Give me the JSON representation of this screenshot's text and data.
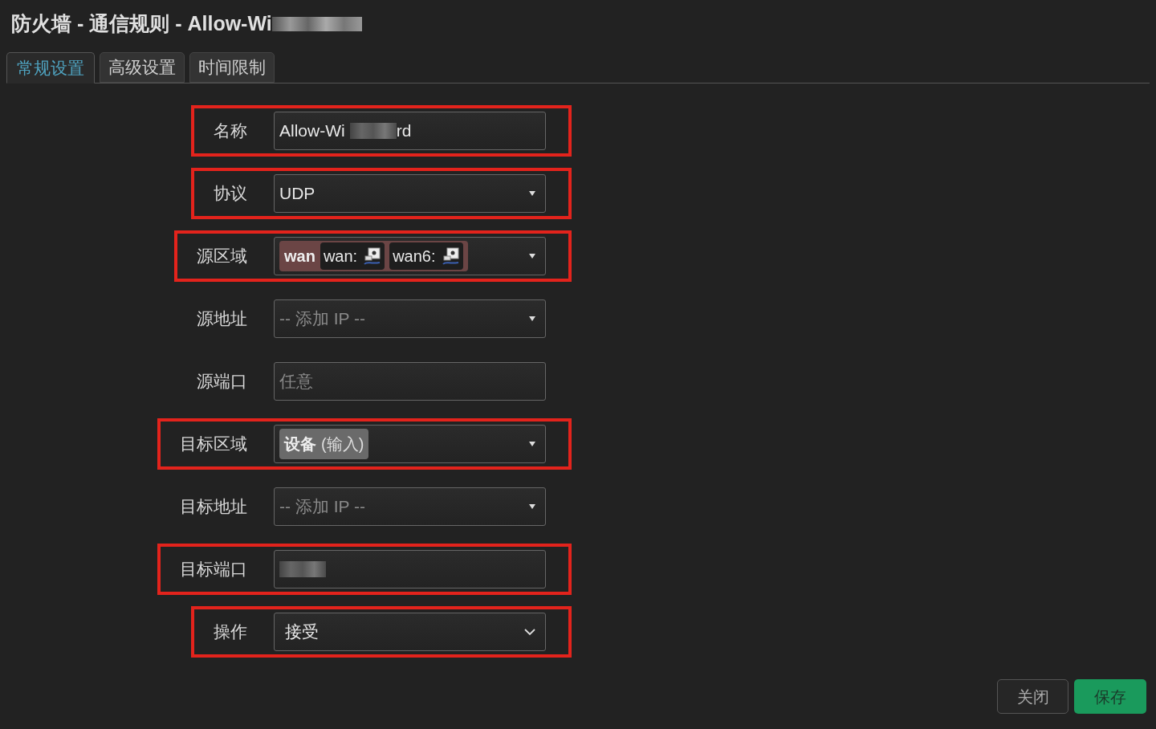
{
  "title": {
    "text": "防火墙 - 通信规则 - Allow-Wi",
    "redacted_tail": true
  },
  "tabs": [
    {
      "label": "常规设置",
      "selected": true
    },
    {
      "label": "高级设置",
      "selected": false
    },
    {
      "label": "时间限制",
      "selected": false
    }
  ],
  "fields": [
    {
      "kind": "text",
      "label": "名称",
      "value": "Allow-Wi",
      "value_end": "rd",
      "redacted": true,
      "highlighted": true
    },
    {
      "kind": "dropdown",
      "label": "协议",
      "value": "UDP",
      "highlighted": true
    },
    {
      "kind": "zones",
      "label": "源区域",
      "zone": {
        "name": "wan",
        "color": "#6b4545",
        "networks": [
          "wan:",
          "wan6:"
        ]
      },
      "highlighted": true
    },
    {
      "kind": "dropdown",
      "label": "源地址",
      "placeholder": "-- 添加 IP --",
      "highlighted": false
    },
    {
      "kind": "text",
      "label": "源端口",
      "placeholder": "任意",
      "highlighted": false
    },
    {
      "kind": "zones",
      "label": "目标区域",
      "zone": {
        "name": "设备",
        "note": "(输入)",
        "color": "#6a6a6a"
      },
      "highlighted": true
    },
    {
      "kind": "dropdown",
      "label": "目标地址",
      "placeholder": "-- 添加 IP --",
      "highlighted": false
    },
    {
      "kind": "text",
      "label": "目标端口",
      "redacted": true,
      "highlighted": true
    },
    {
      "kind": "select",
      "label": "操作",
      "value": "接受",
      "highlighted": true
    }
  ],
  "buttons": [
    {
      "label": "关闭",
      "kind": "secondary"
    },
    {
      "label": "保存",
      "kind": "primary"
    }
  ]
}
